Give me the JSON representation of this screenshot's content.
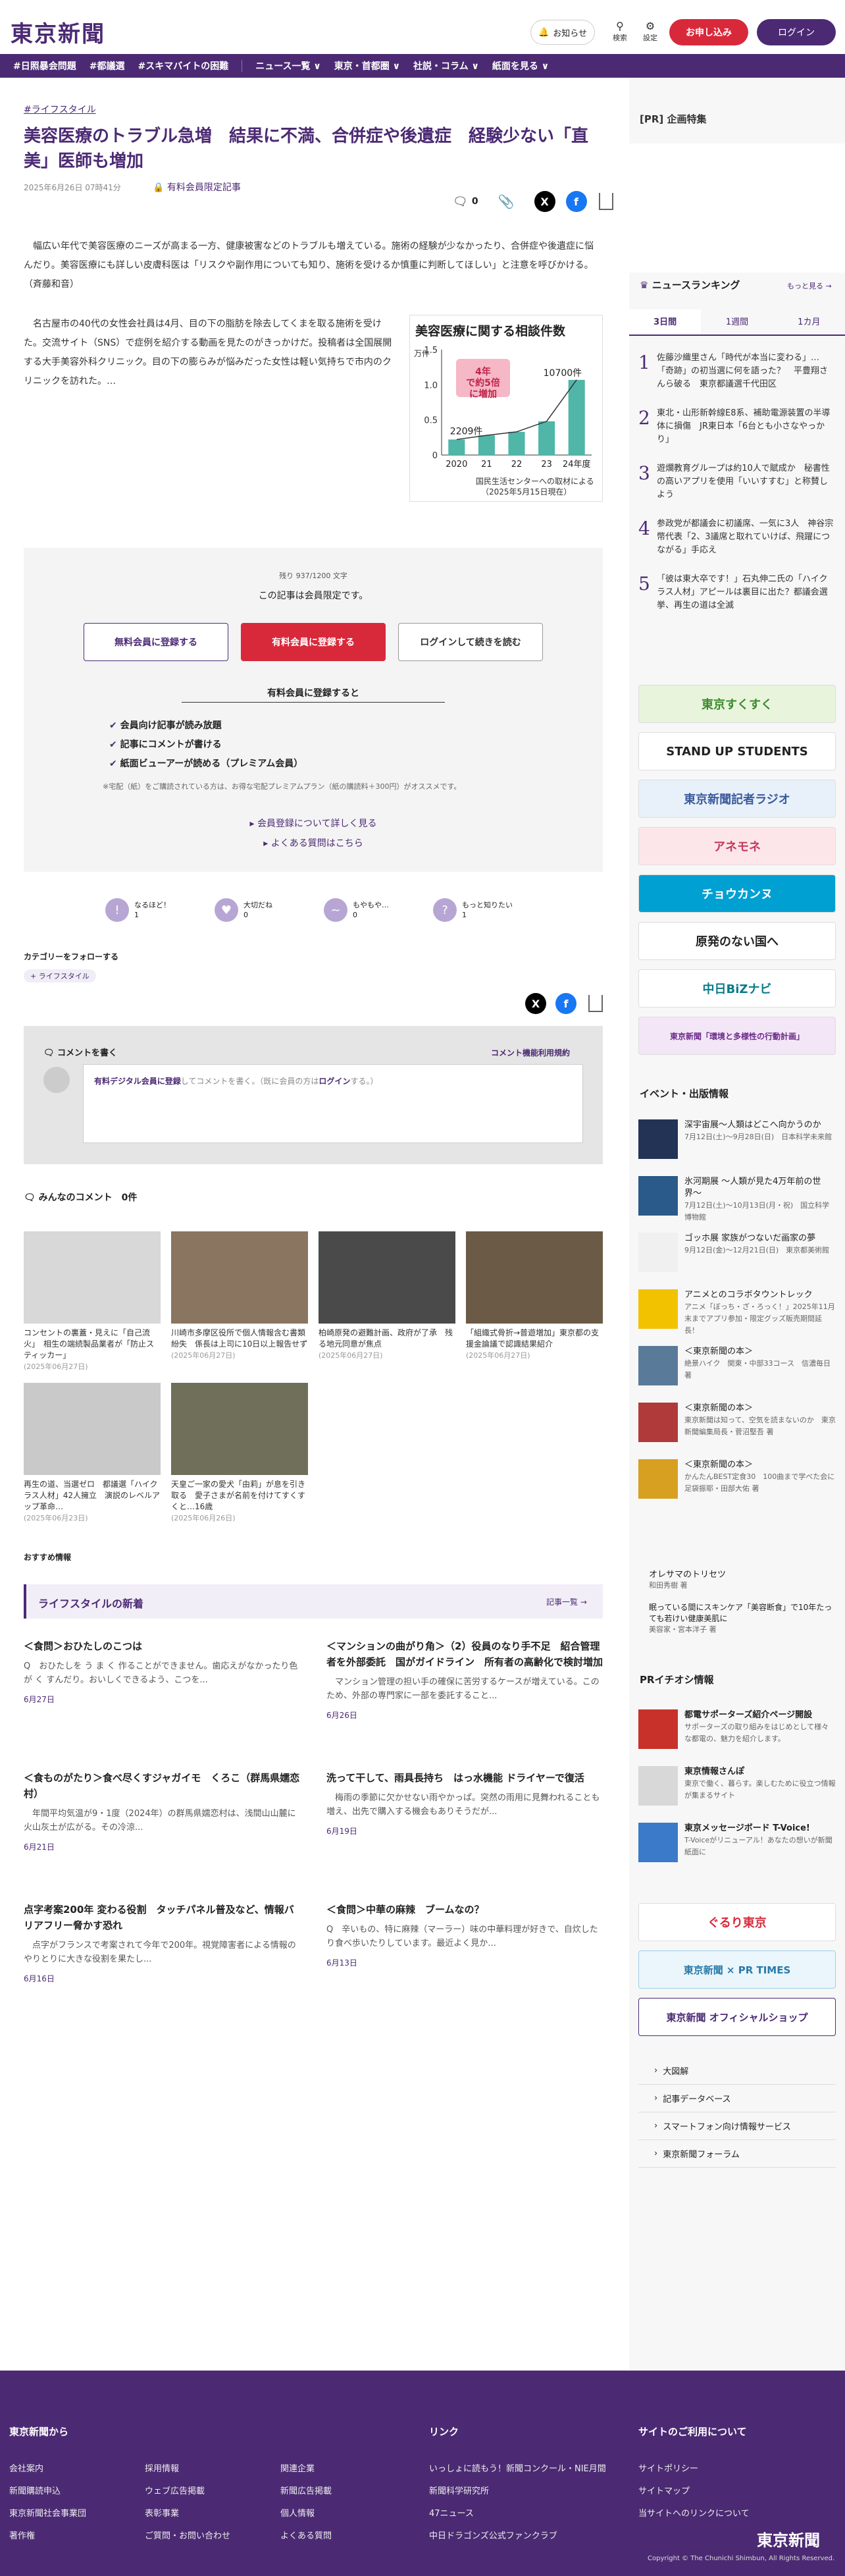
{
  "header": {
    "logo": "東京新聞",
    "notice_label": "お知らせ",
    "search_label": "検索",
    "settings_label": "設定",
    "apply_label": "お申し込み",
    "login_label": "ログイン"
  },
  "nav": {
    "items": [
      "#日照暴会問題",
      "#都議選",
      "#スキマバイトの困難",
      "ニュース一覧 ∨",
      "東京・首都圏 ∨",
      "社説・コラム ∨",
      "紙面を見る ∨"
    ]
  },
  "article": {
    "category": "#ライフスタイル",
    "title": "美容医療のトラブル急増　結果に不満、合併症や後遺症　経験少ない「直美」医師も増加",
    "date": "2025年6月26日 07時41分",
    "paid_label": "有料会員限定記事",
    "comment_count": "0",
    "lead": "　幅広い年代で美容医療のニーズが高まる一方、健康被害などのトラブルも増えている。施術の経験が少なかったり、合併症や後遺症に悩んだり。美容医療にも詳しい皮膚科医は「リスクや副作用についても知り、施術を受けるか慎重に判断してほしい」と注意を呼びかける。（斉藤和音）",
    "body": "　名古屋市の40代の女性会社員は4月、目の下の脂肪を除去してくまを取る施術を受けた。交流サイト（SNS）で症例を紹介する動画を見たのがきっかけだ。投稿者は全国展開する大手美容外科クリニック。目の下の膨らみが悩みだった女性は軽い気持ちで市内のクリニックを訪れた。…"
  },
  "chart_data": {
    "type": "bar",
    "title": "美容医療に関する相談件数",
    "categories": [
      "2020",
      "21",
      "22",
      "23",
      "24年度"
    ],
    "values": [
      2209,
      2800,
      3300,
      4800,
      10700
    ],
    "ylabel": "万件",
    "yticks": [
      "0",
      "0.5",
      "1.0",
      "1.5"
    ],
    "ylim": [
      0,
      15000
    ],
    "annotation": "4年で約5倍に増加",
    "first_label": "2209件",
    "last_label": "10700件",
    "source": "国民生活センターへの取材による（2025年5月15日現在）",
    "color": "#4fb6a8"
  },
  "gate": {
    "remaining": "残り 937/1200 文字",
    "members_only": "この記事は会員限定です。",
    "free_btn": "無料会員に登録する",
    "paid_btn": "有料会員に登録する",
    "login_btn": "ログインして続きを読む",
    "benefits_title": "有料会員に登録すると",
    "benefits": [
      "会員向け記事が読み放題",
      "記事にコメントが書ける",
      "紙面ビューアーが読める（プレミアム会員）"
    ],
    "note": "※宅配（紙）をご購読されている方は、お得な宅配プレミアムプラン（紙の購読料＋300円）がオススメです。",
    "link1": "会員登録について詳しく見る",
    "link2": "よくある質問はこちら"
  },
  "reactions": [
    {
      "label": "なるほど！",
      "count": "1",
      "icon": "!"
    },
    {
      "label": "大切だね",
      "count": "0",
      "icon": "♥"
    },
    {
      "label": "もやもや…",
      "count": "0",
      "icon": "~"
    },
    {
      "label": "もっと知りたい",
      "count": "1",
      "icon": "?"
    }
  ],
  "follow": {
    "label": "カテゴリーをフォローする",
    "tag": "ライフスタイル"
  },
  "comment_form": {
    "title": "コメントを書く",
    "terms": "コメント機能利用規約",
    "prompt_link": "有料デジタル会員に登録",
    "prompt_mid": "してコメントを書く。（既に会員の方は",
    "prompt_login": "ログイン",
    "prompt_end": "する。）"
  },
  "comments": {
    "label": "みんなのコメント",
    "count": "0件"
  },
  "related": [
    {
      "title": "コンセントの裏蓋・見えに「自己流火」　相生の端続製品業者が「防止スティッカー」",
      "date": "(2025年06月27日)",
      "color": "#d8d8d8"
    },
    {
      "title": "川崎市多摩区役所で個人情報含む書類紛失　係長は上司に10日以上報告せず",
      "date": "(2025年06月27日)",
      "color": "#8a7560"
    },
    {
      "title": "柏崎原発の避難計画、政府が了承　残る地元同意が焦点",
      "date": "(2025年06月27日)",
      "color": "#4a4a4a"
    },
    {
      "title": "「組織式骨折→普遊増加」東京都の支援金論議で認識結果紹介",
      "date": "(2025年06月27日)",
      "color": "#6b5a45"
    },
    {
      "title": "再生の道、当選ゼロ　都議選「ハイクラス人材」42人擁立　演説のレベルアップ革命…",
      "date": "(2025年06月23日)",
      "color": "#c9c9c9"
    },
    {
      "title": "天皇ご一家の愛犬「由莉」が息を引き取る　愛子さまが名前を付けてすくすくと…16歳",
      "date": "(2025年06月26日)",
      "color": "#6f6f5a"
    }
  ],
  "osusume": "おすすめ情報",
  "latest": {
    "title": "ライフスタイルの新着",
    "more": "記事一覧",
    "items": [
      {
        "title": "＜食問＞おひたしのこつは",
        "summary": "Q　おひたしを う ま く 作ることができません。歯応えがなかったり色が く すんだり。おいしくできるよう、こつを...",
        "date": "6月27日"
      },
      {
        "title": "＜マンションの曲がり角＞（2）役員のなり手不足　紹合管理者を外部委託　国がガイドライン　所有者の高齢化で検討増加",
        "summary": "　マンション管理の担い手の確保に苦労するケースが増えている。このため、外部の専門家に一部を委託すること...",
        "date": "6月26日"
      },
      {
        "title": "＜食ものがたり＞食べ尽くすジャガイモ　くろこ（群馬県嬬恋村）",
        "summary": "　年間平均気温が9・1度（2024年）の群馬県嬬恋村は、浅間山山麓に火山灰土が広がる。その冷涼...",
        "date": "6月21日"
      },
      {
        "title": "洗って干して、雨具長持ち　はっ水機能 ドライヤーで復活",
        "summary": "　梅雨の季節に欠かせない雨やかっぱ。突然の雨用に見舞われることも増え、出先で購入する機会もありそうだが...",
        "date": "6月19日"
      },
      {
        "title": "点字考案200年 変わる役割　タッチパネル普及など、情報バリアフリー脅かす恐れ",
        "summary": "　点字がフランスで考案されて今年で200年。視覚障害者による情報のやりとりに大きな役割を果たし...",
        "date": "6月16日"
      },
      {
        "title": "＜食問＞中華の麻辣　ブームなの？",
        "summary": "Q　辛いもの、特に麻辣（マーラー）味の中華料理が好きで、自炊したり食べ歩いたりしています。最近よく見か...",
        "date": "6月13日"
      }
    ]
  },
  "sidebar": {
    "pr_title": "[PR] 企画特集",
    "ranking_title": "ニュースランキング",
    "ranking_more": "もっと見る",
    "tabs": [
      "3日間",
      "1週間",
      "1カ月"
    ],
    "ranking": [
      {
        "n": "1",
        "text": "佐藤沙織里さん「時代が本当に変わる」…「奇跡」の初当選に何を語った？　平豊翔さんら破る　東京都議選千代田区"
      },
      {
        "n": "2",
        "text": "東北・山形新幹線E8系、補助電源装置の半導体に損傷　JR東日本「6台とも小さなやっかり」"
      },
      {
        "n": "3",
        "text": "遊爛教育グループは約10人で賦成か　秘書性の高いアプリを使用「いいすすむ」と称賛しよう"
      },
      {
        "n": "4",
        "text": "参政党が都議会に初議席、一気に3人　神谷宗幣代表「2、3議席と取れていけば、飛躍につながる」手応え"
      },
      {
        "n": "5",
        "text": "「彼は東大卒です！」石丸伸二氏の「ハイクラス人材」アピールは裏目に出た？都議会選挙、再生の道は全滅"
      }
    ],
    "banners": [
      {
        "label": "東京すくすく",
        "bg": "#e8f4dc",
        "fg": "#3a8a2a"
      },
      {
        "label": "STAND UP STUDENTS",
        "bg": "#ffffff",
        "fg": "#222222"
      },
      {
        "label": "東京新聞記者ラジオ",
        "bg": "#e8f0fa",
        "fg": "#3a5a9a"
      },
      {
        "label": "アネモネ",
        "bg": "#fde6ea",
        "fg": "#c33a5a"
      },
      {
        "label": "チョウカンヌ",
        "bg": "#00a0d2",
        "fg": "#ffffff"
      },
      {
        "label": "原発のない国へ",
        "bg": "#ffffff",
        "fg": "#222222"
      },
      {
        "label": "中日BiZナビ",
        "bg": "#ffffff",
        "fg": "#0a7a8a"
      },
      {
        "label": "東京新聞「環境と多様性の行動計画」",
        "bg": "#f3e6f7",
        "fg": "#6a2a8a"
      }
    ],
    "events_title": "イベント・出版情報",
    "events": [
      {
        "title": "深宇宙展〜人類はどこへ向かうのか",
        "sub": "7月12日(土)〜9月28日(日)　日本科学未来館",
        "color": "#223355"
      },
      {
        "title": "氷河期展 〜人類が見た4万年前の世界〜",
        "sub": "7月12日(土)〜10月13日(月・祝)　国立科学博物館",
        "color": "#2a5a8a"
      },
      {
        "title": "ゴッホ展 家族がつないだ画家の夢",
        "sub": "9月12日(金)〜12月21日(日)　東京都美術館",
        "color": "#f0f0f0"
      },
      {
        "title": "アニメとのコラボタウントレック",
        "sub": "アニメ「ぼっち・ざ・ろっく！」2025年11月末までアプリ参加・限定グッズ販売期間延長！",
        "color": "#f2c200"
      },
      {
        "title": "＜東京新聞の本＞",
        "sub": "絶景ハイク　関東・中部33コース　信濃毎日 著",
        "color": "#5a7a9a"
      },
      {
        "title": "＜東京新聞の本＞",
        "sub": "東京新聞は知って、空気を読まないのか　東京新聞編集局長・菅沼堅吾 著",
        "color": "#b03a3a"
      },
      {
        "title": "＜東京新聞の本＞",
        "sub": "かんたんBEST定食30　100曲まで学べた会に　足袋振耶・田部大佑 著",
        "color": "#d8a020"
      }
    ],
    "book_extra": [
      {
        "title": "オレサマのトリセツ",
        "sub": "和田秀樹 著"
      },
      {
        "title": "眠っている間にスキンケア「美容断食」で10年たっても若けい健康美肌に",
        "sub": "美容家・宮本洋子 著"
      }
    ],
    "pr_events_title": "PRイチオシ情報",
    "pr_events": [
      {
        "title": "都電サポーターズ紹介ページ開設",
        "sub": "サポーターズの取り組みをはじめとして様々な都電の、魅力を紹介します。",
        "color": "#c8302a"
      },
      {
        "title": "東京情報さんぽ",
        "sub": "東京で働く、暮らす。楽しむために役立つ情報が集まるサイト",
        "color": "#d8d8d8"
      },
      {
        "title": "東京メッセージボード T-Voice!",
        "sub": "T-Voiceがリニューアル！あなたの想いが新聞紙面に",
        "color": "#3a7ac8"
      }
    ],
    "promo": [
      "ぐるり東京",
      "東京新聞 × PR TIMES",
      "東京新聞 オフィシャルショップ"
    ],
    "links": [
      "大図解",
      "記事データベース",
      "スマートフォン向け情報サービス",
      "東京新聞フォーラム"
    ]
  },
  "footer": {
    "col1_title": "東京新聞から",
    "col1": [
      "会社案内",
      "採用情報",
      "関連企業",
      "新聞購読申込",
      "ウェブ広告掲載",
      "新聞広告掲載",
      "東京新聞社会事業団",
      "表彰事業",
      "個人情報",
      "著作権",
      "ご質問・お問い合わせ",
      "よくある質問"
    ],
    "col2_title": "リンク",
    "col2": [
      "いっしょに読もう！新聞コンクール・NIE月間",
      "新聞科学研究所",
      "47ニュース",
      "中日ドラゴンズ公式ファンクラブ"
    ],
    "col3_title": "サイトのご利用について",
    "col3": [
      "サイトポリシー",
      "サイトマップ",
      "当サイトへのリンクについて"
    ],
    "logo": "東京新聞",
    "copyright": "Copyright © The Chunichi Shimbun, All Rights Reserved."
  }
}
